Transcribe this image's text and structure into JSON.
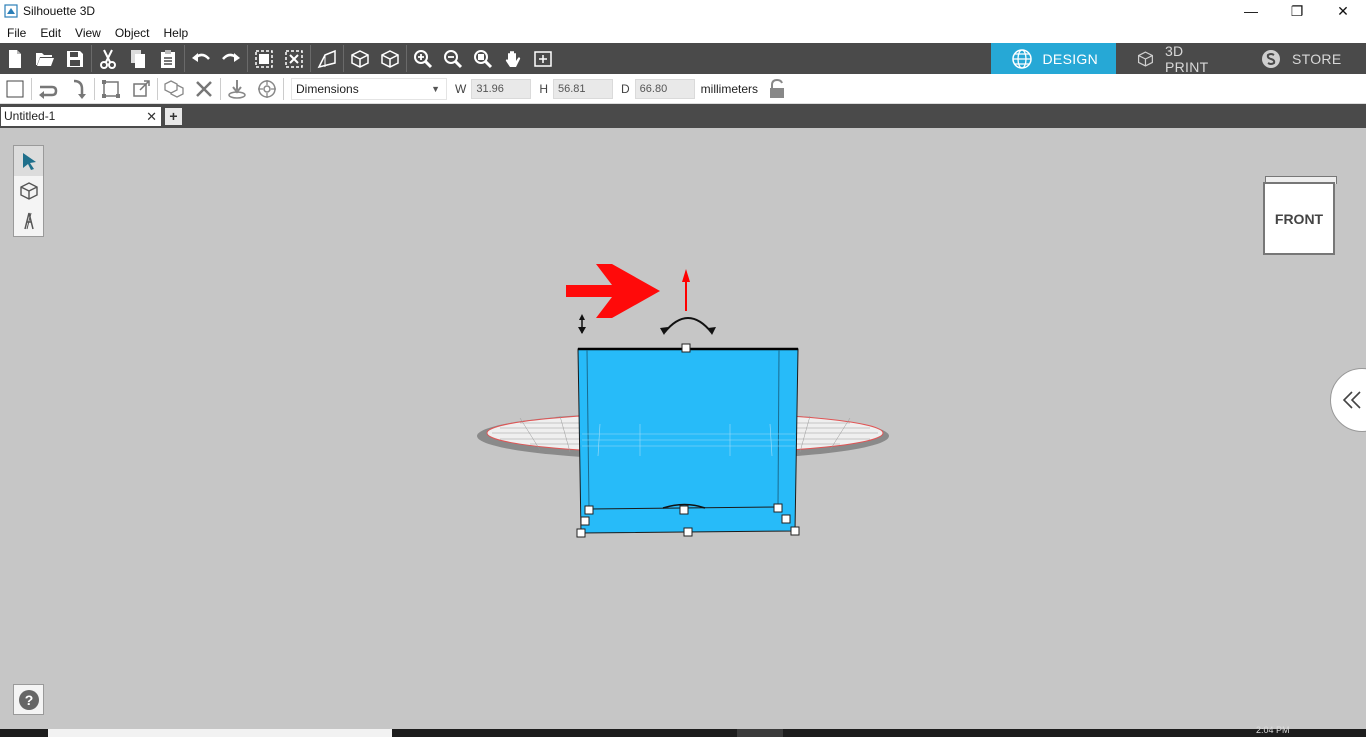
{
  "window": {
    "title": "Silhouette 3D",
    "minimize": "—",
    "maximize": "❐",
    "close": "✕"
  },
  "menu": [
    "File",
    "Edit",
    "View",
    "Object",
    "Help"
  ],
  "modes": [
    {
      "label": "DESIGN",
      "icon": "globe-icon",
      "active": true
    },
    {
      "label": "3D PRINT",
      "icon": "print-3d-icon",
      "active": false
    },
    {
      "label": "STORE",
      "icon": "store-icon",
      "active": false
    }
  ],
  "properties": {
    "mode_select": "Dimensions",
    "w_label": "W",
    "w_value": "31.96",
    "h_label": "H",
    "h_value": "56.81",
    "d_label": "D",
    "d_value": "66.80",
    "units": "millimeters"
  },
  "doc_tabs": [
    {
      "label": "Untitled-1",
      "close": "✕"
    }
  ],
  "doc_add": "+",
  "view_cube": {
    "face": "FRONT"
  },
  "help": "?",
  "colors": {
    "accent": "#26a8d6",
    "object": "#27bbf9",
    "toolbar": "#4a4a4a",
    "workspace": "#c6c6c6",
    "annotation": "#ff0000"
  },
  "taskbar": {
    "clock": "2:04 PM"
  }
}
